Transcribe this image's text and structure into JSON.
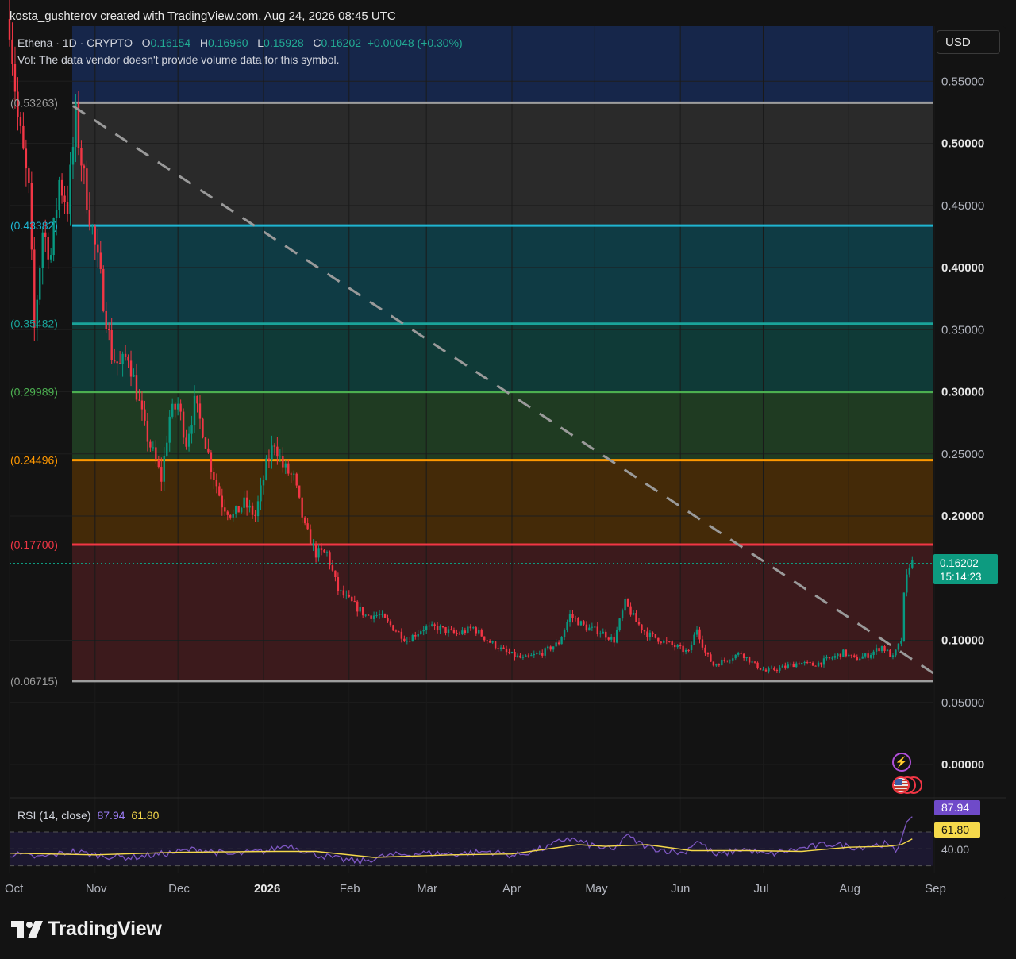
{
  "header": {
    "text": "kosta_gushterov created with TradingView.com, Aug 24, 2026 08:45 UTC"
  },
  "legend": {
    "symbol": "Ethena · 1D · CRYPTO",
    "open_label": "O",
    "open": "0.16154",
    "high_label": "H",
    "high": "0.16960",
    "low_label": "L",
    "low": "0.15928",
    "close_label": "C",
    "close": "0.16202",
    "change": "+0.00048 (+0.30%)",
    "volume_note": "Vol: The data vendor doesn't provide volume data for this symbol."
  },
  "currency_button": {
    "label": "USD"
  },
  "price_axis": {
    "labels": [
      "0.55000",
      "0.50000",
      "0.45000",
      "0.40000",
      "0.35000",
      "0.30000",
      "0.25000",
      "0.20000",
      "0.10000",
      "0.05000",
      "0.00000"
    ],
    "bold_labels": [
      "0.50000",
      "0.40000",
      "0.30000",
      "0.20000",
      "0.10000",
      "0.00000"
    ]
  },
  "current_price": {
    "price": "0.16202",
    "countdown": "15:14:23"
  },
  "fib_levels": [
    {
      "label": "(0.53263)",
      "value": 0.53263,
      "color": "#9e9e9e"
    },
    {
      "label": "(0.43382)",
      "value": 0.43382,
      "color": "#1fb4d0"
    },
    {
      "label": "(0.35482)",
      "value": 0.35482,
      "color": "#1aa39a"
    },
    {
      "label": "(0.29989)",
      "value": 0.29989,
      "color": "#4caf50"
    },
    {
      "label": "(0.24496)",
      "value": 0.24496,
      "color": "#ff9800"
    },
    {
      "label": "(0.17700)",
      "value": 0.177,
      "color": "#f23645"
    },
    {
      "label": "(0.06715)",
      "value": 0.06715,
      "color": "#9e9e9e"
    }
  ],
  "time_axis": {
    "labels": [
      "Oct",
      "Nov",
      "Dec",
      "2026",
      "Feb",
      "Mar",
      "Apr",
      "May",
      "Jun",
      "Jul",
      "Aug",
      "Sep"
    ],
    "bold": [
      "2026"
    ]
  },
  "rsi": {
    "title": "RSI (14, close)",
    "rsi_value": "87.94",
    "ma_value": "61.80",
    "axis_label": "40.00",
    "colors": {
      "rsi": "#7e57c2",
      "ma": "#f5d94b"
    }
  },
  "footer": {
    "brand": "TradingView"
  },
  "chart_data": {
    "type": "candlestick",
    "symbol": "Ethena",
    "interval": "1D",
    "ylim": [
      0.0,
      0.57
    ],
    "start_date": "2025-10-01",
    "end_date": "2026-08-24",
    "trend_line": {
      "from": [
        "2025-10-24",
        0.53
      ],
      "to": [
        "2026-09-03",
        0.07
      ]
    },
    "price_path": [
      [
        "2025-10-01",
        0.6
      ],
      [
        "2025-10-04",
        0.52
      ],
      [
        "2025-10-08",
        0.46
      ],
      [
        "2025-10-10",
        0.35
      ],
      [
        "2025-10-13",
        0.43
      ],
      [
        "2025-10-16",
        0.41
      ],
      [
        "2025-10-19",
        0.47
      ],
      [
        "2025-10-22",
        0.45
      ],
      [
        "2025-10-25",
        0.52
      ],
      [
        "2025-10-28",
        0.47
      ],
      [
        "2025-10-31",
        0.43
      ],
      [
        "2025-11-03",
        0.39
      ],
      [
        "2025-11-07",
        0.33
      ],
      [
        "2025-11-10",
        0.32
      ],
      [
        "2025-11-13",
        0.33
      ],
      [
        "2025-11-16",
        0.3
      ],
      [
        "2025-11-19",
        0.27
      ],
      [
        "2025-11-22",
        0.25
      ],
      [
        "2025-11-25",
        0.23
      ],
      [
        "2025-11-28",
        0.28
      ],
      [
        "2025-12-01",
        0.29
      ],
      [
        "2025-12-04",
        0.26
      ],
      [
        "2025-12-07",
        0.29
      ],
      [
        "2025-12-10",
        0.27
      ],
      [
        "2025-12-13",
        0.24
      ],
      [
        "2025-12-17",
        0.21
      ],
      [
        "2025-12-21",
        0.2
      ],
      [
        "2025-12-25",
        0.21
      ],
      [
        "2025-12-29",
        0.2
      ],
      [
        "2026-01-02",
        0.24
      ],
      [
        "2026-01-05",
        0.26
      ],
      [
        "2026-01-08",
        0.24
      ],
      [
        "2026-01-12",
        0.23
      ],
      [
        "2026-01-16",
        0.19
      ],
      [
        "2026-01-20",
        0.17
      ],
      [
        "2026-01-24",
        0.17
      ],
      [
        "2026-01-28",
        0.14
      ],
      [
        "2026-02-02",
        0.13
      ],
      [
        "2026-02-07",
        0.12
      ],
      [
        "2026-02-12",
        0.12
      ],
      [
        "2026-02-17",
        0.11
      ],
      [
        "2026-02-22",
        0.1
      ],
      [
        "2026-02-28",
        0.11
      ],
      [
        "2026-03-05",
        0.11
      ],
      [
        "2026-03-12",
        0.105
      ],
      [
        "2026-03-18",
        0.11
      ],
      [
        "2026-03-23",
        0.1
      ],
      [
        "2026-03-30",
        0.09
      ],
      [
        "2026-04-05",
        0.085
      ],
      [
        "2026-04-12",
        0.09
      ],
      [
        "2026-04-18",
        0.098
      ],
      [
        "2026-04-22",
        0.12
      ],
      [
        "2026-04-28",
        0.11
      ],
      [
        "2026-05-03",
        0.107
      ],
      [
        "2026-05-08",
        0.1
      ],
      [
        "2026-05-12",
        0.13
      ],
      [
        "2026-05-16",
        0.115
      ],
      [
        "2026-05-20",
        0.105
      ],
      [
        "2026-05-25",
        0.1
      ],
      [
        "2026-05-30",
        0.095
      ],
      [
        "2026-06-04",
        0.09
      ],
      [
        "2026-06-07",
        0.11
      ],
      [
        "2026-06-10",
        0.09
      ],
      [
        "2026-06-13",
        0.08
      ],
      [
        "2026-06-18",
        0.085
      ],
      [
        "2026-06-23",
        0.09
      ],
      [
        "2026-06-28",
        0.08
      ],
      [
        "2026-07-02",
        0.075
      ],
      [
        "2026-07-08",
        0.078
      ],
      [
        "2026-07-14",
        0.082
      ],
      [
        "2026-07-19",
        0.08
      ],
      [
        "2026-07-25",
        0.085
      ],
      [
        "2026-07-30",
        0.09
      ],
      [
        "2026-08-03",
        0.085
      ],
      [
        "2026-08-08",
        0.088
      ],
      [
        "2026-08-13",
        0.095
      ],
      [
        "2026-08-17",
        0.086
      ],
      [
        "2026-08-20",
        0.1
      ],
      [
        "2026-08-21",
        0.135
      ],
      [
        "2026-08-22",
        0.15
      ],
      [
        "2026-08-23",
        0.162
      ],
      [
        "2026-08-24",
        0.162
      ]
    ],
    "rsi_path": [
      [
        "2025-10-01",
        44
      ],
      [
        "2025-10-12",
        40
      ],
      [
        "2025-10-24",
        47
      ],
      [
        "2025-11-03",
        42
      ],
      [
        "2025-11-14",
        40
      ],
      [
        "2025-11-28",
        45
      ],
      [
        "2025-12-08",
        50
      ],
      [
        "2025-12-20",
        43
      ],
      [
        "2026-01-03",
        48
      ],
      [
        "2026-01-10",
        55
      ],
      [
        "2026-01-18",
        45
      ],
      [
        "2026-01-28",
        38
      ],
      [
        "2026-02-05",
        35
      ],
      [
        "2026-02-15",
        42
      ],
      [
        "2026-02-28",
        45
      ],
      [
        "2026-03-12",
        44
      ],
      [
        "2026-03-24",
        47
      ],
      [
        "2026-04-02",
        42
      ],
      [
        "2026-04-14",
        52
      ],
      [
        "2026-04-21",
        63
      ],
      [
        "2026-04-29",
        55
      ],
      [
        "2026-05-08",
        48
      ],
      [
        "2026-05-12",
        66
      ],
      [
        "2026-05-20",
        52
      ],
      [
        "2026-06-02",
        45
      ],
      [
        "2026-06-07",
        60
      ],
      [
        "2026-06-14",
        42
      ],
      [
        "2026-06-24",
        50
      ],
      [
        "2026-07-02",
        43
      ],
      [
        "2026-07-14",
        50
      ],
      [
        "2026-07-25",
        56
      ],
      [
        "2026-08-04",
        52
      ],
      [
        "2026-08-14",
        56
      ],
      [
        "2026-08-18",
        47
      ],
      [
        "2026-08-20",
        62
      ],
      [
        "2026-08-22",
        82
      ],
      [
        "2026-08-24",
        88
      ]
    ],
    "rsi_ma_path": [
      [
        "2025-10-01",
        45
      ],
      [
        "2025-11-01",
        43
      ],
      [
        "2025-12-01",
        46
      ],
      [
        "2026-01-05",
        47
      ],
      [
        "2026-01-20",
        47
      ],
      [
        "2026-02-10",
        40
      ],
      [
        "2026-03-10",
        43
      ],
      [
        "2026-04-01",
        44
      ],
      [
        "2026-04-25",
        55
      ],
      [
        "2026-05-05",
        53
      ],
      [
        "2026-05-20",
        55
      ],
      [
        "2026-06-05",
        48
      ],
      [
        "2026-06-25",
        48
      ],
      [
        "2026-07-15",
        47
      ],
      [
        "2026-08-01",
        52
      ],
      [
        "2026-08-15",
        53
      ],
      [
        "2026-08-20",
        55
      ],
      [
        "2026-08-24",
        61.8
      ]
    ]
  }
}
